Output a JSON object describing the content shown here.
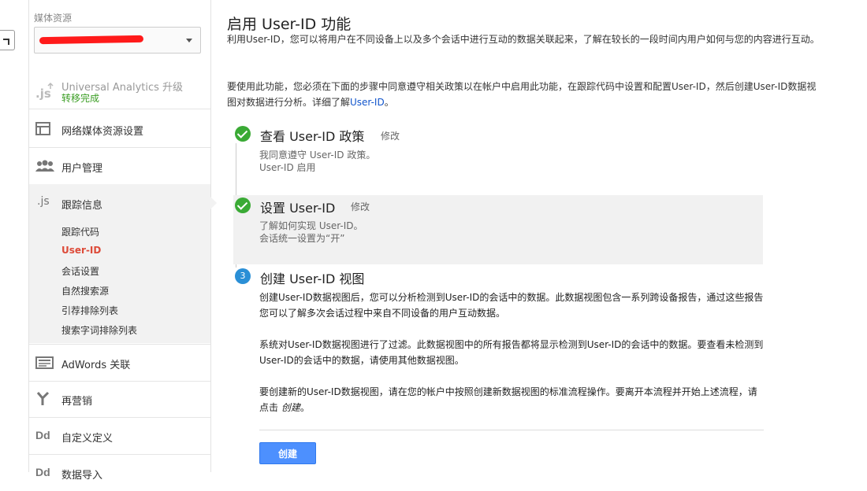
{
  "sidebar": {
    "property_label": "媒体资源",
    "property_select_value": "",
    "items": [
      {
        "name": "universal-analytics",
        "label": "Universal Analytics 升级",
        "sub": "转移完成",
        "icon": ".js"
      },
      {
        "name": "property-settings",
        "label": "网络媒体资源设置",
        "icon": "window-icon"
      },
      {
        "name": "user-management",
        "label": "用户管理",
        "icon": "people-icon"
      },
      {
        "name": "tracking-info",
        "label": "跟踪信息",
        "icon": ".js"
      },
      {
        "name": "adwords-link",
        "label": "AdWords 关联",
        "icon": "adwords-icon"
      },
      {
        "name": "remarketing",
        "label": "再营销",
        "icon": "fork-icon"
      },
      {
        "name": "custom-definitions",
        "label": "自定义定义",
        "icon": "Dd"
      },
      {
        "name": "data-import",
        "label": "数据导入",
        "icon": "Dd"
      }
    ],
    "tracking_subitems": [
      "跟踪代码",
      "User-ID",
      "会话设置",
      "自然搜索源",
      "引荐排除列表",
      "搜索字词排除列表"
    ]
  },
  "main": {
    "title": "启用 User-ID 功能",
    "intro": "利用User-ID，您可以将用户在不同设备上以及多个会话中进行互动的数据关联起来，了解在较长的一段时间内用户如何与您的内容进行互动。",
    "usage_text": "要使用此功能，您必须在下面的步骤中同意遵守相关政策以在帐户中启用此功能，在跟踪代码中设置和配置User-ID，然后创建User-ID数据视图对数据进行分析。详细了解",
    "usage_link": "User-ID",
    "usage_end": "。",
    "steps": [
      {
        "title": "查看 User-ID 政策",
        "edit": "修改",
        "lines": [
          "我同意遵守 User-ID 政策。",
          "User-ID 启用"
        ]
      },
      {
        "title": "设置 User-ID",
        "edit": "修改",
        "lines": [
          "了解如何实现 User-ID。",
          "会话统一设置为“开”"
        ]
      },
      {
        "number": "3",
        "title": "创建 User-ID 视图",
        "p1": "创建User-ID数据视图后，您可以分析检测到User-ID的会话中的数据。此数据视图包含一系列跨设备报告，通过这些报告您可以了解多次会话过程中来自不同设备的用户互动数据。",
        "p2": "系统对User-ID数据视图进行了过滤。此数据视图中的所有报告都将显示检测到User-ID的会话中的数据。要查看未检测到User-ID的会话中的数据，请使用其他数据视图。",
        "p3_start": "要创建新的User-ID数据视图，请在您的帐户中按照创建新数据视图的标准流程操作。要离开本流程并开始上述流程，请点击 ",
        "p3_em": "创建",
        "p3_end": "。"
      }
    ],
    "create_button": "创建"
  },
  "colors": {
    "accent": "#4d90fe",
    "success": "#3aaa35",
    "step_number": "#2a8fd6",
    "active_nav": "#dd4b39",
    "link": "#15c"
  }
}
